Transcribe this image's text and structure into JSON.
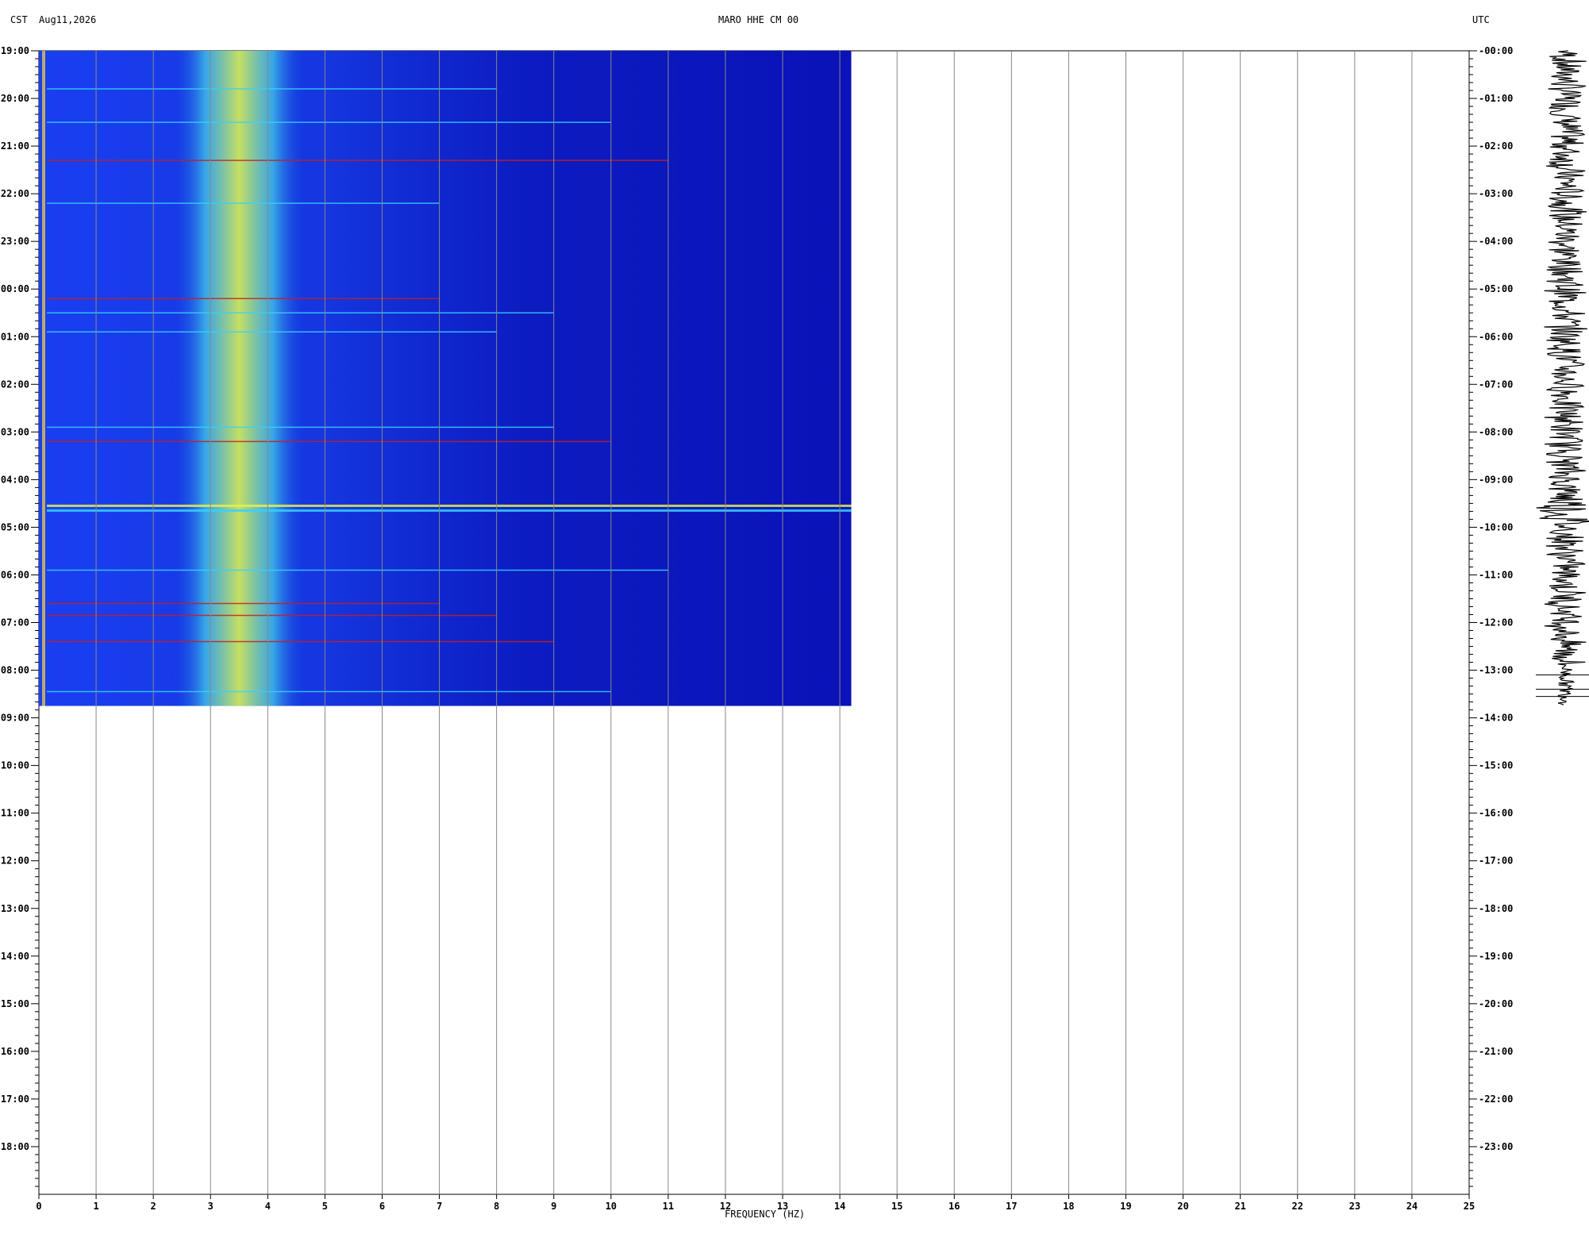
{
  "header": {
    "left_timezone": "CST",
    "date": "Aug11,2026",
    "station": "MARO HHE CM 00",
    "right_timezone": "UTC"
  },
  "chart_data": {
    "type": "heatmap",
    "title": "MARO HHE CM 00",
    "xlabel": "FREQUENCY (HZ)",
    "xlim": [
      0,
      25
    ],
    "x_ticks": [
      "0",
      "1",
      "2",
      "3",
      "4",
      "5",
      "6",
      "7",
      "8",
      "9",
      "10",
      "11",
      "12",
      "13",
      "14",
      "15",
      "16",
      "17",
      "18",
      "19",
      "20",
      "21",
      "22",
      "23",
      "24",
      "25"
    ],
    "left_time_labels": [
      "19:00",
      "20:00",
      "21:00",
      "22:00",
      "23:00",
      "00:00",
      "01:00",
      "02:00",
      "03:00",
      "04:00",
      "05:00",
      "06:00",
      "07:00",
      "08:00",
      "09:00",
      "10:00",
      "11:00",
      "12:00",
      "13:00",
      "14:00",
      "15:00",
      "16:00",
      "17:00",
      "18:00"
    ],
    "right_time_labels": [
      "00:00",
      "01:00",
      "02:00",
      "03:00",
      "04:00",
      "05:00",
      "06:00",
      "07:00",
      "08:00",
      "09:00",
      "10:00",
      "11:00",
      "12:00",
      "13:00",
      "14:00",
      "15:00",
      "16:00",
      "17:00",
      "18:00",
      "19:00",
      "20:00",
      "21:00",
      "22:00",
      "23:00"
    ],
    "data_extent": {
      "freq_max_hz": 14.2,
      "hours_recorded": 13.75
    },
    "energy_band_hz": [
      2.9,
      4.1
    ],
    "event_lines_hours": [
      5.2,
      5.9,
      7.9,
      8.2,
      9.55,
      9.65,
      11.85,
      5.5,
      1.5,
      2.3,
      3.2,
      0.8,
      12.4,
      13.45,
      10.9,
      11.6
    ],
    "colors": {
      "low": "#0a12b8",
      "mid": "#1f7cff",
      "high": "#e6f24a",
      "peak": "#c81e1e",
      "grid": "#888888"
    }
  }
}
